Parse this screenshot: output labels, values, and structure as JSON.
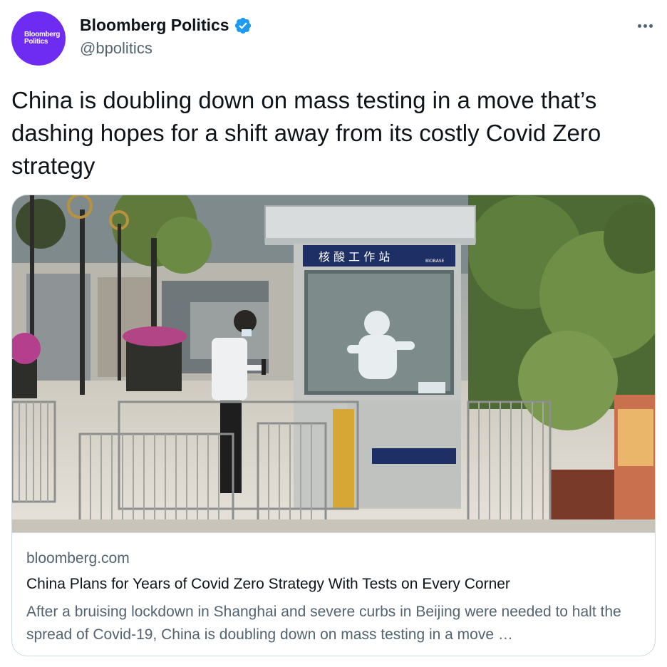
{
  "author": {
    "avatar_text_line1": "Bloomberg",
    "avatar_text_line2": "Politics",
    "display_name": "Bloomberg Politics",
    "handle": "@bpolitics",
    "verified": true,
    "avatar_color": "#6e2cf3"
  },
  "tweet": {
    "text": "China is doubling down on mass testing in a move that’s dashing hopes for a shift away from its costly Covid Zero strategy"
  },
  "card": {
    "image_sign_text": "核 酸 工 作 站",
    "image_sign_brand": "BIOBASE",
    "domain": "bloomberg.com",
    "title": "China Plans for Years of Covid Zero Strategy With Tests on Every Corner",
    "description": "After a bruising lockdown in Shanghai and severe curbs in Beijing were needed to halt the spread of Covid-19, China is doubling down on mass testing in a move …"
  },
  "icons": {
    "verified": "verified-badge-icon",
    "more": "more-options-icon"
  },
  "colors": {
    "accent": "#1d9bf0",
    "text_primary": "#0f1419",
    "text_secondary": "#536471",
    "border": "#cfd9de"
  }
}
